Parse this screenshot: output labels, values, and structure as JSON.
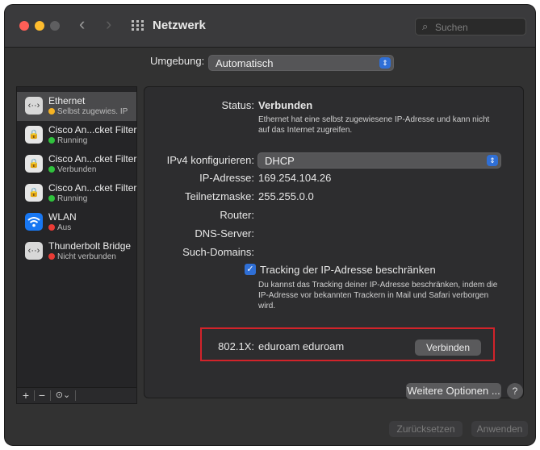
{
  "window": {
    "title": "Netzwerk",
    "search_placeholder": "Suchen",
    "nav_back": "‹",
    "nav_forward": "›"
  },
  "location": {
    "label": "Umgebung:",
    "value": "Automatisch"
  },
  "sidebar": {
    "items": [
      {
        "name": "Ethernet",
        "status": "Selbst zugewies. IP",
        "status_color": "#f5b324",
        "icon": "ethernet-icon",
        "selected": true
      },
      {
        "name": "Cisco An...cket Filter",
        "status": "Running",
        "status_color": "#30c23d",
        "icon": "lock-icon"
      },
      {
        "name": "Cisco An...cket Filter",
        "status": "Verbunden",
        "status_color": "#30c23d",
        "icon": "lock-icon"
      },
      {
        "name": "Cisco An...cket Filter",
        "status": "Running",
        "status_color": "#30c23d",
        "icon": "lock-icon"
      },
      {
        "name": "WLAN",
        "status": "Aus",
        "status_color": "#ea3b35",
        "icon": "wifi-icon"
      },
      {
        "name": "Thunderbolt Bridge",
        "status": "Nicht verbunden",
        "status_color": "#ea3b35",
        "icon": "ethernet-icon"
      }
    ],
    "toolbar": {
      "add": "+",
      "remove": "−",
      "action": "⊙⌄"
    }
  },
  "details": {
    "status_label": "Status:",
    "status_value": "Verbunden",
    "status_desc": "Ethernet hat eine selbst zugewiesene IP-Adresse und kann nicht auf das Internet zugreifen.",
    "ipv4_label": "IPv4 konfigurieren:",
    "ipv4_value": "DHCP",
    "ip_label": "IP-Adresse:",
    "ip_value": "169.254.104.26",
    "subnet_label": "Teilnetzmaske:",
    "subnet_value": "255.255.0.0",
    "router_label": "Router:",
    "dns_label": "DNS-Server:",
    "search_domains_label": "Such-Domains:",
    "tracking_label": "Tracking der IP-Adresse beschränken",
    "tracking_checked": true,
    "tracking_desc": "Du kannst das Tracking deiner IP-Adresse beschränken, indem die IP-Adresse vor bekannten Trackern in Mail und Safari verborgen wird.",
    "dot1x_label": "802.1X:",
    "dot1x_value": "eduroam eduroam",
    "connect_button": "Verbinden",
    "more_options_button": "Weitere Optionen ...",
    "help": "?"
  },
  "footer": {
    "revert_button": "Zurücksetzen",
    "apply_button": "Anwenden"
  },
  "colors": {
    "accent": "#2f6fd6",
    "highlight_box": "#d2232a"
  }
}
